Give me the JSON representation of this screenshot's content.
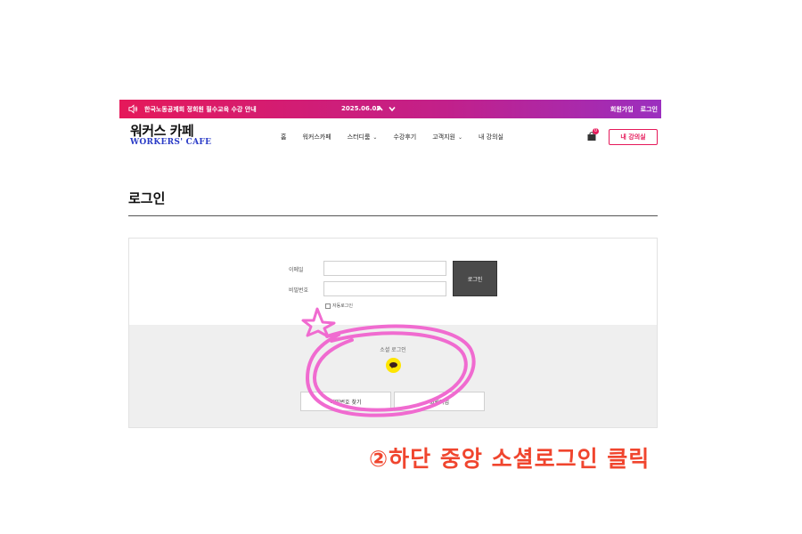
{
  "topbar": {
    "notice": "한국노동공제회 정회원 필수교육 수강 안내",
    "date": "2025.06.05",
    "links": [
      "회원가입",
      "로그인"
    ]
  },
  "header": {
    "logo_ko": "워커스 카페",
    "logo_en": "WORKERS' CAFE",
    "nav": [
      {
        "label": "홈",
        "has_dropdown": false
      },
      {
        "label": "워커스카페",
        "has_dropdown": false
      },
      {
        "label": "스터디룸",
        "has_dropdown": true
      },
      {
        "label": "수강후기",
        "has_dropdown": false
      },
      {
        "label": "고객지원",
        "has_dropdown": true
      },
      {
        "label": "내 강의실",
        "has_dropdown": false
      }
    ],
    "cart_count": "0",
    "my_course_button": "내 강의실"
  },
  "page_title": "로그인",
  "login": {
    "email_label": "이메일",
    "email_value": "",
    "password_label": "비밀번호",
    "password_value": "",
    "login_button": "로그인",
    "auto_login_label": "자동로그인",
    "social_label": "소셜 로그인",
    "find_password_button": "비밀번호 찾기",
    "signup_button": "회원가입"
  },
  "annotation": {
    "text": "②하단 중앙 소셜로그인 클릭",
    "color": "#f0452e",
    "highlight_color": "#f06bd0"
  }
}
